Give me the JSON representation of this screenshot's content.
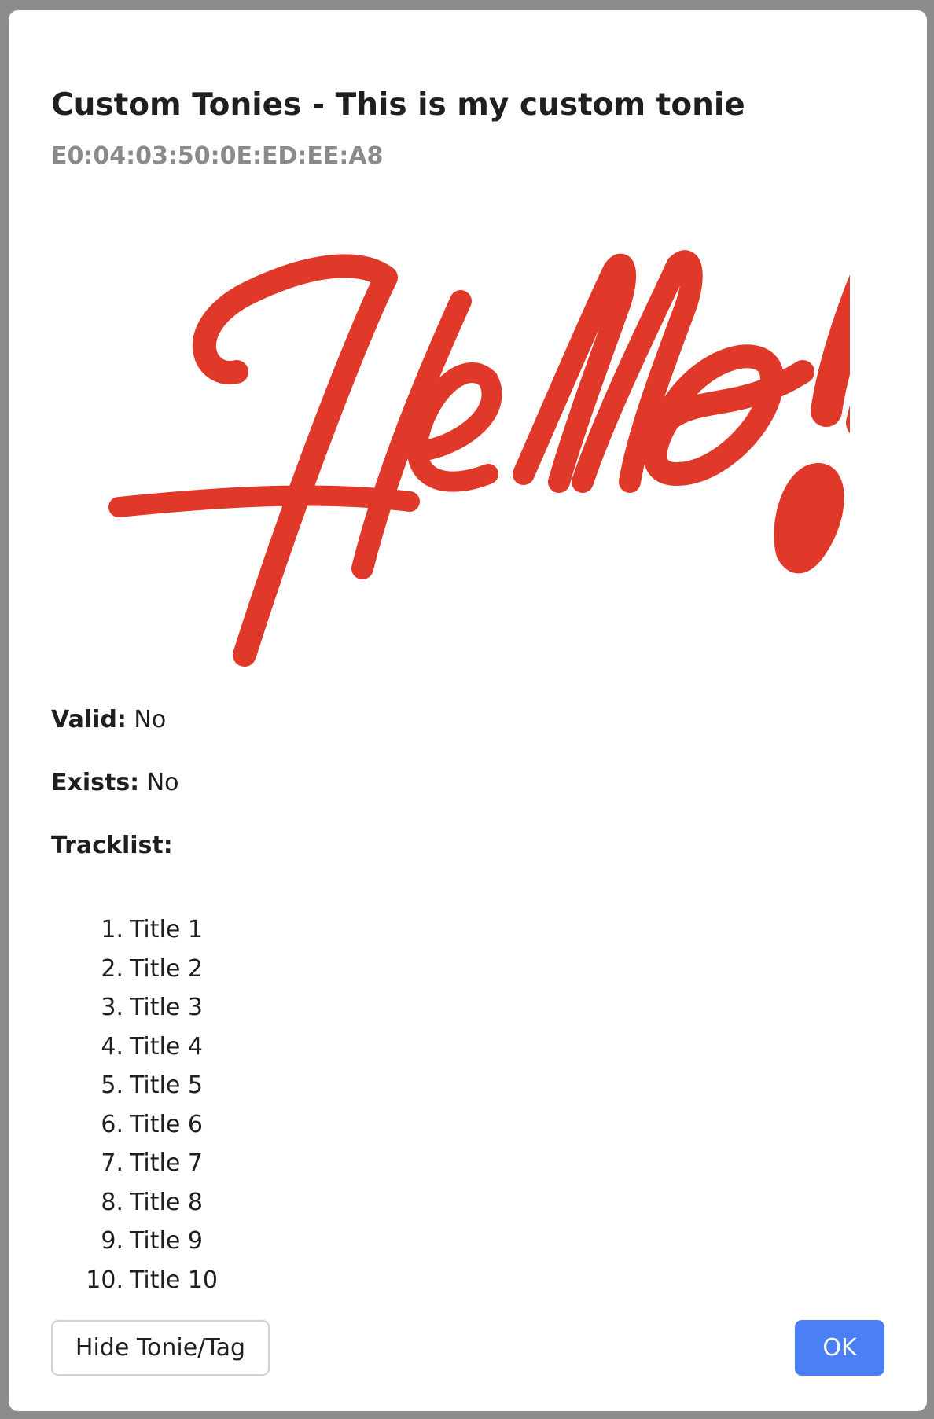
{
  "modal": {
    "title": "Custom Tonies - This is my custom tonie",
    "subtitle": "E0:04:03:50:0E:ED:EE:A8",
    "image_text": "Hello!",
    "image_color": "#e0392a",
    "valid": {
      "label": "Valid:",
      "value": "No"
    },
    "exists": {
      "label": "Exists:",
      "value": "No"
    },
    "tracklist": {
      "label": "Tracklist:",
      "items": [
        {
          "num": "1.",
          "title": "Title 1"
        },
        {
          "num": "2.",
          "title": "Title 2"
        },
        {
          "num": "3.",
          "title": "Title 3"
        },
        {
          "num": "4.",
          "title": "Title 4"
        },
        {
          "num": "5.",
          "title": "Title 5"
        },
        {
          "num": "6.",
          "title": "Title 6"
        },
        {
          "num": "7.",
          "title": "Title 7"
        },
        {
          "num": "8.",
          "title": "Title 8"
        },
        {
          "num": "9.",
          "title": "Title 9"
        },
        {
          "num": "10.",
          "title": "Title 10"
        }
      ]
    },
    "buttons": {
      "hide_label": "Hide Tonie/Tag",
      "ok_label": "OK"
    }
  },
  "colors": {
    "primary": "#4a7ff5",
    "backdrop": "#8c8c8c",
    "muted_text": "#8a8a8a"
  }
}
